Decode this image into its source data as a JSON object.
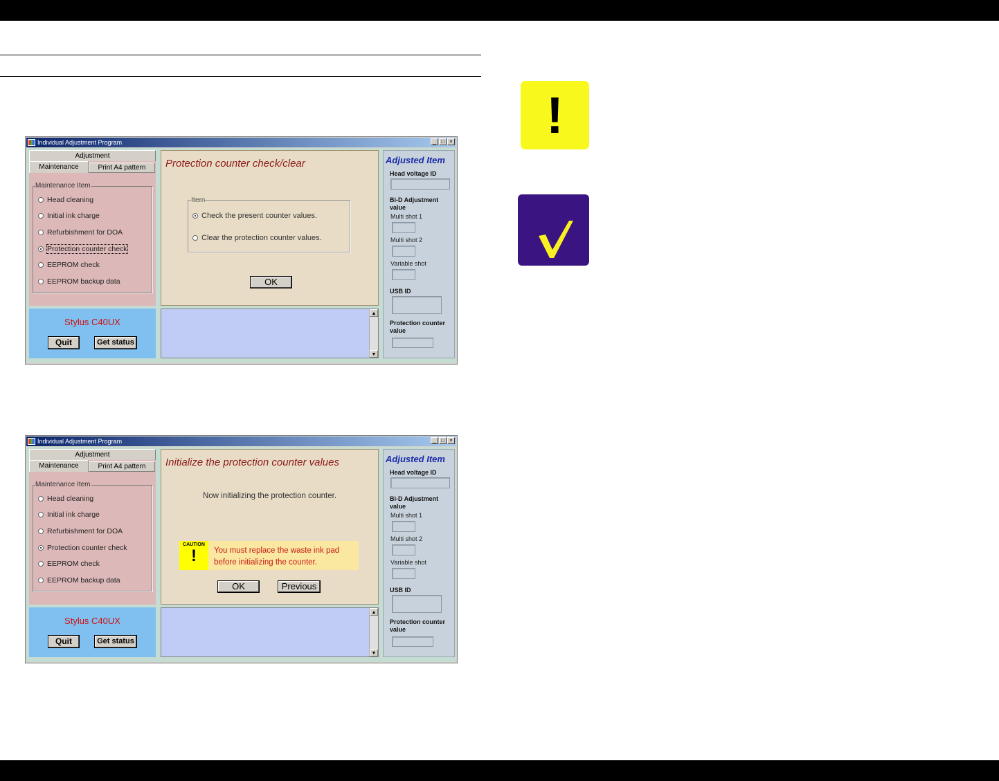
{
  "window1": {
    "title": "Individual Adjustment Program",
    "tab_group": "Adjustment",
    "tab_active": "Maintenance",
    "tab_inactive": "Print A4 pattern",
    "group_label": "Maintenance Item",
    "items": [
      "Head cleaning",
      "Initial ink charge",
      "Refurbishment for DOA",
      "Protection counter check",
      "EEPROM check",
      "EEPROM backup data"
    ],
    "selected_item": "Protection counter check",
    "panel_title": "Protection counter check/clear",
    "item_box_label": "Item",
    "options": [
      "Check the present counter values.",
      "Clear the protection counter values."
    ],
    "ok_label": "OK",
    "model": "Stylus C40UX",
    "quit_label": "Quit",
    "get_status_label": "Get status"
  },
  "window2": {
    "title": "Individual Adjustment Program",
    "tab_group": "Adjustment",
    "tab_active": "Maintenance",
    "tab_inactive": "Print A4 pattern",
    "group_label": "Maintenance Item",
    "items": [
      "Head cleaning",
      "Initial ink charge",
      "Refurbishment for DOA",
      "Protection counter check",
      "EEPROM check",
      "EEPROM backup data"
    ],
    "selected_item": "Protection counter check",
    "panel_title": "Initialize the protection counter values",
    "status_text": "Now initializing the protection counter.",
    "caution_word": "CAUTION",
    "caution_line1": "You must replace the waste ink pad",
    "caution_line2": "before initializing the counter.",
    "ok_label": "OK",
    "previous_label": "Previous",
    "model": "Stylus C40UX",
    "quit_label": "Quit",
    "get_status_label": "Get status"
  },
  "adjusted": {
    "title": "Adjusted Item",
    "head_voltage": "Head voltage ID",
    "bid": "Bi-D Adjustment value",
    "multi1": "Multi shot 1",
    "multi2": "Multi shot 2",
    "variable": "Variable shot",
    "usb": "USB ID",
    "protection": "Protection counter value"
  },
  "title_buttons": {
    "minimize": "_",
    "maximize": "□",
    "close": "×"
  },
  "icons": {
    "warning": "exclamation-icon",
    "check": "checkmark-icon"
  },
  "colors": {
    "warning_bg": "#f8f81c",
    "check_bg": "#3a1480",
    "check_mark": "#f8f020"
  }
}
